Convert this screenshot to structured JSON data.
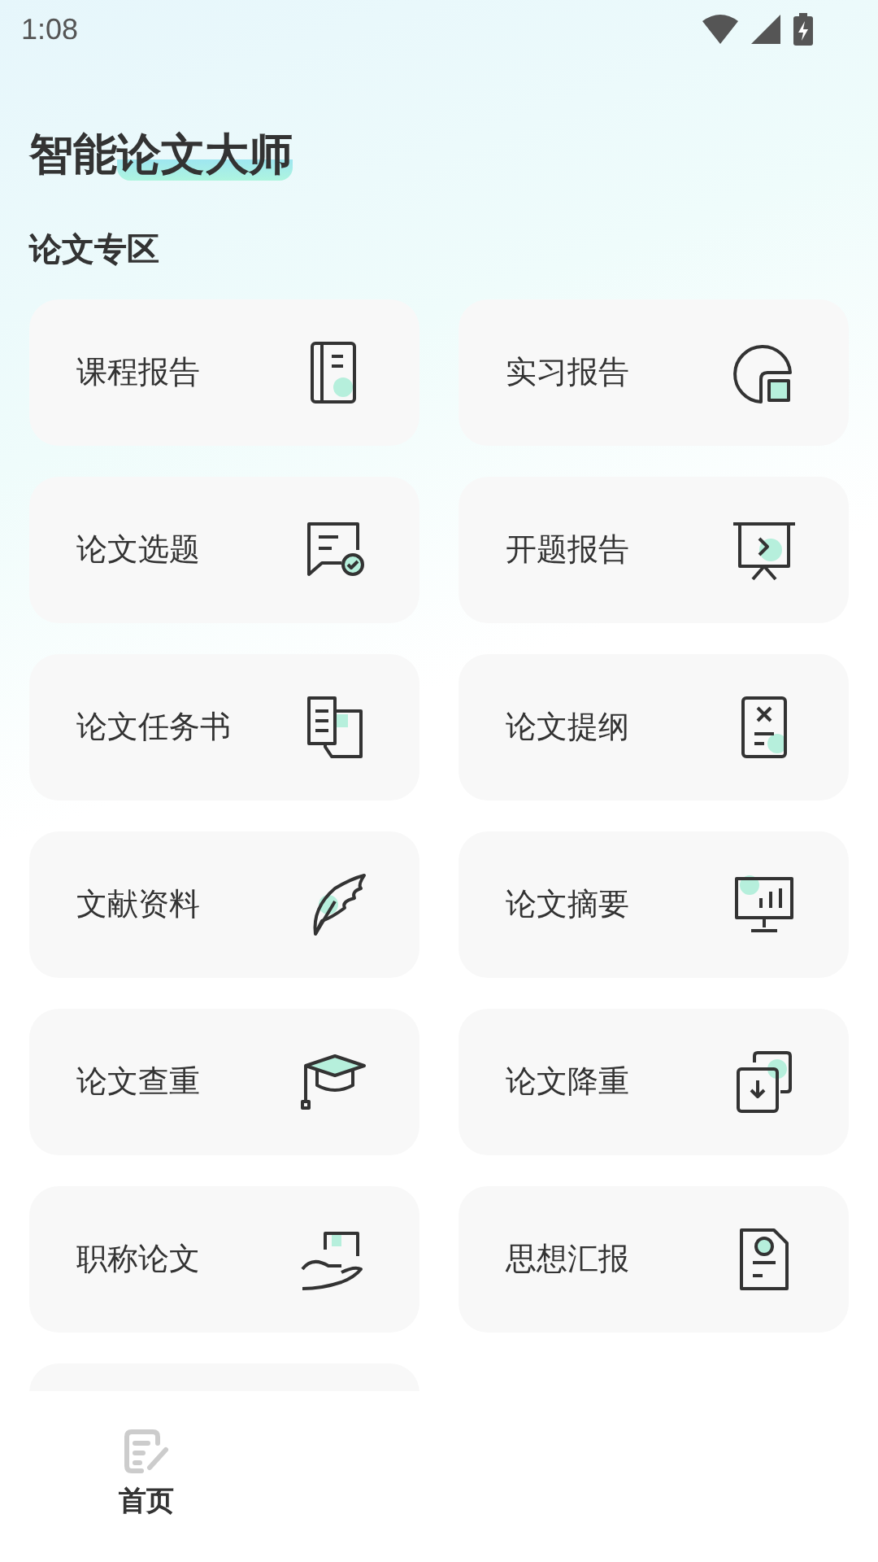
{
  "status_bar": {
    "time": "1:08"
  },
  "app_title": {
    "plain": "智能",
    "highlighted": "论文大师"
  },
  "section_title": "论文专区",
  "cards": [
    {
      "label": "课程报告"
    },
    {
      "label": "实习报告"
    },
    {
      "label": "论文选题"
    },
    {
      "label": "开题报告"
    },
    {
      "label": "论文任务书"
    },
    {
      "label": "论文提纲"
    },
    {
      "label": "文献资料"
    },
    {
      "label": "论文摘要"
    },
    {
      "label": "论文查重"
    },
    {
      "label": "论文降重"
    },
    {
      "label": "职称论文"
    },
    {
      "label": "思想汇报"
    }
  ],
  "bottom_nav": [
    {
      "label": "首页",
      "selected": true
    }
  ]
}
